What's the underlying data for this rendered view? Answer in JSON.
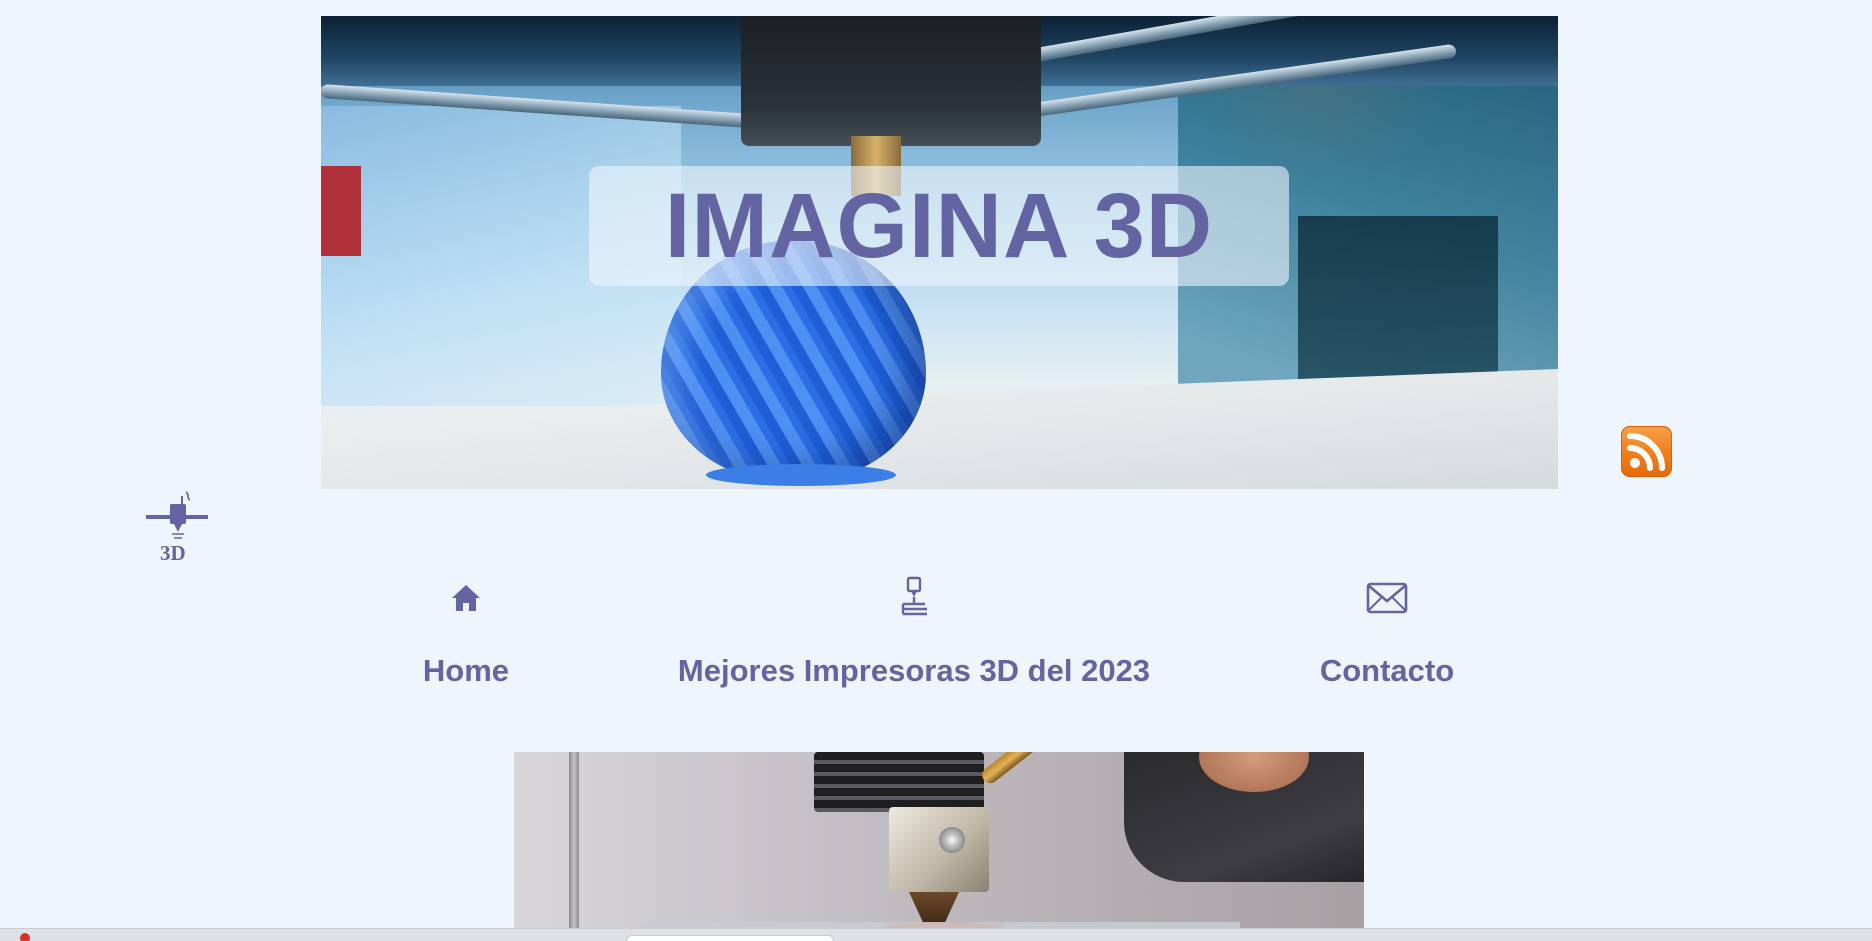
{
  "site": {
    "title": "IMAGINA 3D"
  },
  "icons": {
    "rss": "rss-feed-icon",
    "logo": "3d-printer-logo-icon",
    "home": "home-icon",
    "printer": "3d-printer-icon",
    "contact": "envelope-icon"
  },
  "nav": {
    "items": [
      {
        "label": "Home",
        "icon": "home-icon"
      },
      {
        "label": "Mejores Impresoras 3D del 2023",
        "icon": "3d-printer-icon"
      },
      {
        "label": "Contacto",
        "icon": "envelope-icon"
      }
    ]
  },
  "colors": {
    "background": "#eef5fc",
    "brand": "#6364a1",
    "rss": "#f07d1a",
    "title_box": "rgba(238,245,252,0.6)"
  }
}
